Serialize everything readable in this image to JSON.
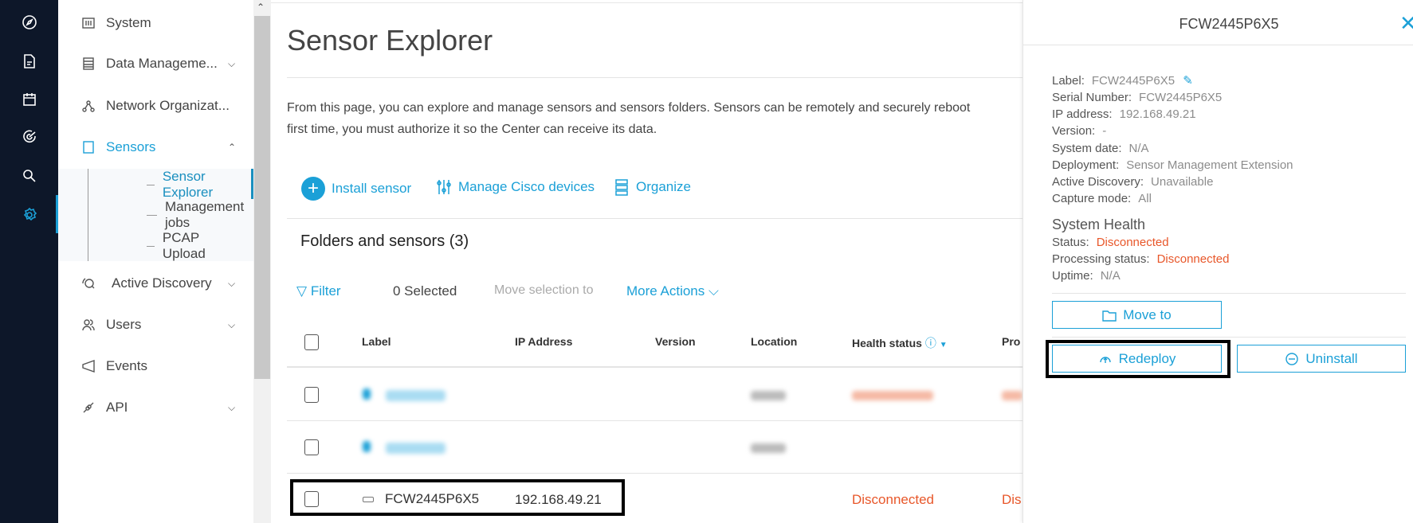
{
  "rail": {
    "icons": [
      "compass-icon",
      "document-icon",
      "calendar-icon",
      "radar-icon",
      "search-icon",
      "gear-icon"
    ],
    "active": "gear-icon",
    "accent": "#1ba0d7"
  },
  "sidebar": {
    "items": [
      {
        "label": "System"
      },
      {
        "label": "Data Manageme..."
      },
      {
        "label": "Network Organizat..."
      },
      {
        "label": "Sensors"
      },
      {
        "label": "Active Discovery"
      },
      {
        "label": "Users"
      },
      {
        "label": "Events"
      },
      {
        "label": "API"
      }
    ],
    "sub": [
      {
        "label": "Sensor Explorer"
      },
      {
        "label": "Management jobs"
      },
      {
        "label": "PCAP Upload"
      }
    ]
  },
  "main": {
    "title": "Sensor Explorer",
    "desc1": "From this page, you can explore and manage sensors and sensors folders. Sensors can be remotely and securely reboot",
    "desc2": "first time, you must authorize it so the Center can receive its data.",
    "actions": {
      "install": "Install sensor",
      "manage": "Manage Cisco devices",
      "organize": "Organize"
    },
    "section": "Folders and sensors (3)",
    "filter": "Filter",
    "selected": "0 Selected",
    "move_selection": "Move selection to",
    "more_actions": "More Actions",
    "columns": {
      "label": "Label",
      "ip": "IP Address",
      "version": "Version",
      "location": "Location",
      "health": "Health status",
      "processing": "Pro"
    },
    "row": {
      "label": "FCW2445P6X5",
      "ip": "192.168.49.21",
      "health": "Disconnected",
      "processing": "Dis"
    }
  },
  "panel": {
    "title": "FCW2445P6X5",
    "fields": [
      {
        "k": "Label:",
        "v": "FCW2445P6X5"
      },
      {
        "k": "Serial Number:",
        "v": "FCW2445P6X5"
      },
      {
        "k": "IP address:",
        "v": "192.168.49.21"
      },
      {
        "k": "Version:",
        "v": "-"
      },
      {
        "k": "System date:",
        "v": "N/A"
      },
      {
        "k": "Deployment:",
        "v": "Sensor Management Extension"
      },
      {
        "k": "Active Discovery:",
        "v": "Unavailable"
      },
      {
        "k": "Capture mode:",
        "v": "All"
      }
    ],
    "health_title": "System Health",
    "health": [
      {
        "k": "Status:",
        "v": "Disconnected"
      },
      {
        "k": "Processing status:",
        "v": "Disconnected"
      },
      {
        "k": "Uptime:",
        "v": "N/A"
      }
    ],
    "buttons": {
      "move": "Move to",
      "redeploy": "Redeploy",
      "uninstall": "Uninstall"
    }
  }
}
